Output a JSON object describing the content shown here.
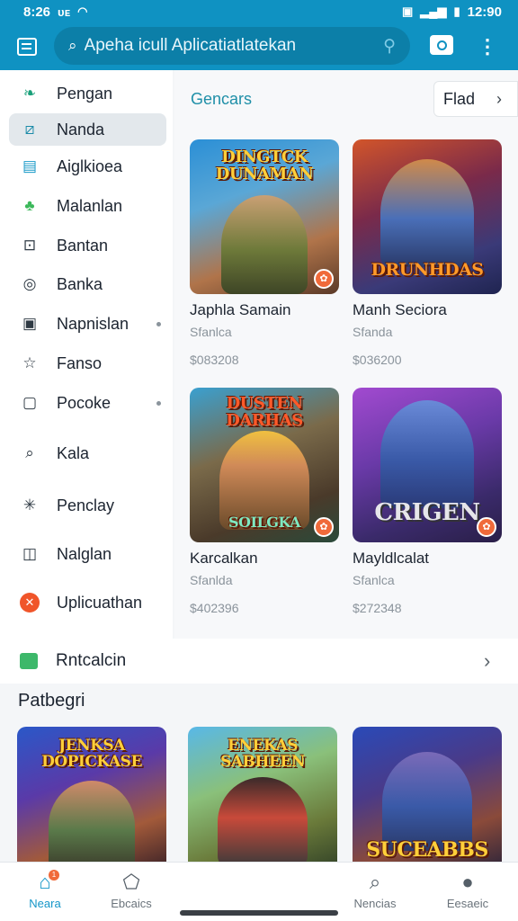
{
  "status_bar": {
    "time": "8:26",
    "carrier": "ᴜᴇ",
    "right_time": "12:90"
  },
  "search": {
    "placeholder": "Apeha icull Aplicatiatlatekan"
  },
  "colors": {
    "accent": "#0f92c2",
    "badge": "#f06a3a",
    "title_teal": "#1f8fa8"
  },
  "sidebar": {
    "items": [
      {
        "label": "Pengan",
        "icon": "leaf-icon"
      },
      {
        "label": "Nanda",
        "icon": "tag-icon"
      },
      {
        "label": "Aiglkioea",
        "icon": "window-icon"
      },
      {
        "label": "Malanlan",
        "icon": "person-icon"
      },
      {
        "label": "Bantan",
        "icon": "shirt-icon"
      },
      {
        "label": "Banka",
        "icon": "disc-icon"
      },
      {
        "label": "Napnislan",
        "icon": "square-icon"
      },
      {
        "label": "Fanso",
        "icon": "star-icon"
      },
      {
        "label": "Pocoke",
        "icon": "frame-icon"
      },
      {
        "label": "Kala",
        "icon": "search-icon"
      },
      {
        "label": "Penclay",
        "icon": "asterisk-icon"
      },
      {
        "label": "Nalglan",
        "icon": "box-icon"
      },
      {
        "label": "Uplicuathan",
        "icon": "cross-badge-icon"
      }
    ]
  },
  "content": {
    "title": "Gencars",
    "filter_label": "Flad",
    "games": [
      {
        "thumb_title": "DINGTCK DUNAMAN",
        "name": "Japhla Samain",
        "sub": "Sfanlca",
        "price": "$083208"
      },
      {
        "thumb_title": "DRUNHDAS",
        "name": "Manh Seciora",
        "sub": "Sfanda",
        "price": "$036200"
      },
      {
        "thumb_title": "DUSTEN DARHAS",
        "name": "Karcalkan",
        "sub": "Sfanlda",
        "price": "$402396"
      },
      {
        "thumb_title": "CRIGEN",
        "name": "Mayldlcalat",
        "sub": "Sfanlca",
        "price": "$272348"
      }
    ]
  },
  "row": {
    "label": "Rntcalcin"
  },
  "section": {
    "title": "Patbegri",
    "cards": [
      {
        "thumb_title": "JENKSA DOPICKASE"
      },
      {
        "thumb_title": "ENEKAS SABHEEN"
      },
      {
        "thumb_title": "SUCEABBS"
      }
    ]
  },
  "bottom_nav": [
    {
      "label": "Neara",
      "icon": "home-icon",
      "active": true
    },
    {
      "label": "Ebcaics",
      "icon": "tag-icon",
      "active": false
    },
    {
      "label": "Nencias",
      "icon": "search-icon",
      "active": false
    },
    {
      "label": "Eesaeic",
      "icon": "user-icon",
      "active": false
    }
  ]
}
